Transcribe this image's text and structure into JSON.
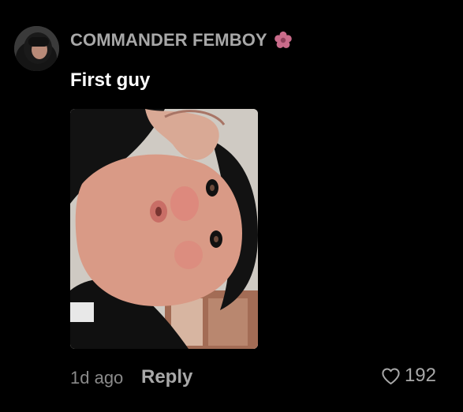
{
  "comment": {
    "username": "COMMANDER FEMBOY",
    "text": "First guy",
    "timestamp": "1d ago",
    "reply_label": "Reply",
    "like_count": "192"
  },
  "icons": {
    "badge": "cherry-blossom-icon",
    "like": "heart-icon"
  },
  "colors": {
    "background": "#000000",
    "username": "#a8a8a8",
    "text": "#ffffff",
    "meta": "#8a8a8a",
    "flower": "#c96b8a"
  }
}
